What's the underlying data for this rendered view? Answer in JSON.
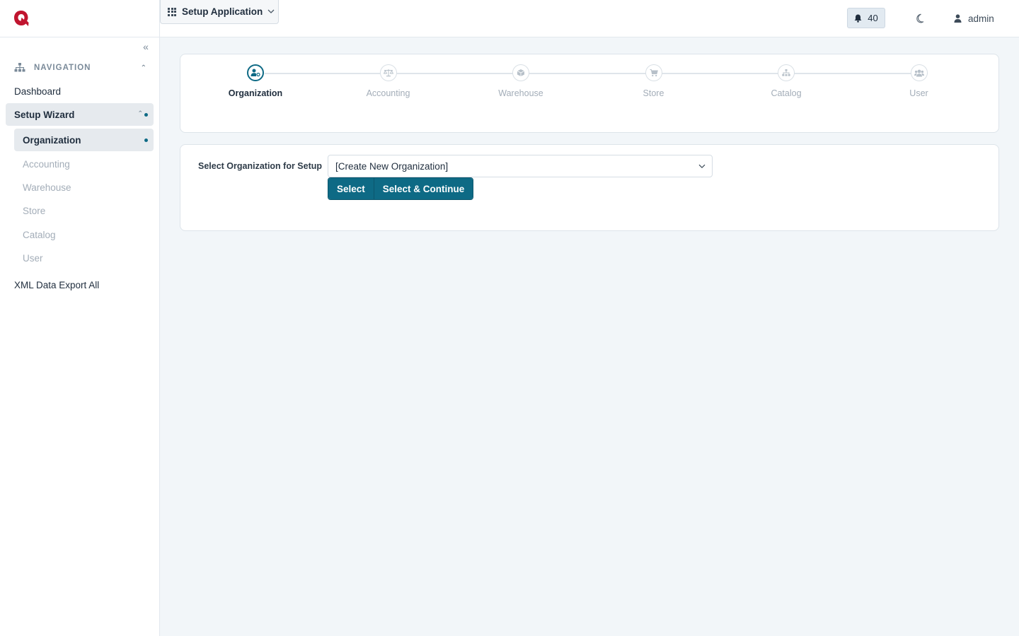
{
  "colors": {
    "accent": "#0e6a85",
    "logo": "#c0152f",
    "muted": "#a3adb8"
  },
  "sidebar": {
    "section_title": "NAVIGATION",
    "items": [
      {
        "label": "Dashboard"
      },
      {
        "label": "Setup Wizard"
      },
      {
        "label": "XML Data Export All"
      }
    ],
    "sub_items": [
      {
        "label": "Organization"
      },
      {
        "label": "Accounting"
      },
      {
        "label": "Warehouse"
      },
      {
        "label": "Store"
      },
      {
        "label": "Catalog"
      },
      {
        "label": "User"
      }
    ]
  },
  "topbar": {
    "app_label": "Setup Application",
    "notification_count": "40",
    "user_name": "admin"
  },
  "wizard": {
    "steps": [
      {
        "label": "Organization",
        "icon": "users-cog-icon"
      },
      {
        "label": "Accounting",
        "icon": "balance-scale-icon"
      },
      {
        "label": "Warehouse",
        "icon": "box-icon"
      },
      {
        "label": "Store",
        "icon": "cart-icon"
      },
      {
        "label": "Catalog",
        "icon": "sitemap-icon"
      },
      {
        "label": "User",
        "icon": "users-icon"
      }
    ]
  },
  "form": {
    "label": "Select Organization for Setup",
    "selected_value": "[Create New Organization]",
    "select_button": "Select",
    "continue_button": "Select & Continue"
  }
}
